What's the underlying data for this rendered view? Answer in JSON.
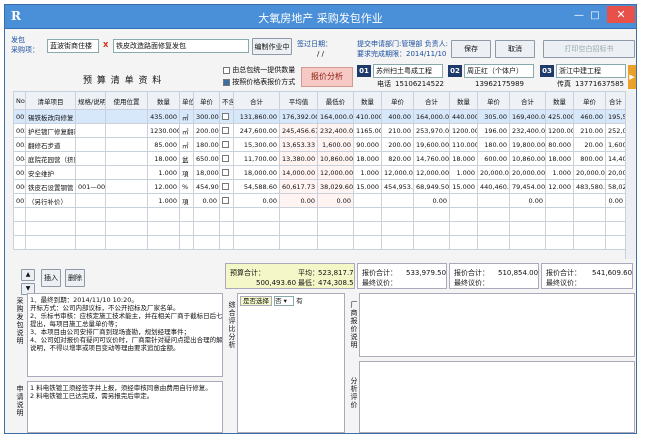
{
  "window": {
    "title": "大氧房地产 采购发包作业",
    "app_icon": "R",
    "min_glyph": "—",
    "max_glyph": "□",
    "close_glyph": "✕"
  },
  "header": {
    "project_label_line1": "发包",
    "project_label_line2": "采购项：",
    "project_value": "蓝波街商住楼",
    "item_value": "铁皮改造路面修复发包",
    "edit_btn": "编制作业中",
    "sign_date_label": "签过日期：",
    "sign_date_value": "/ /",
    "info_line1": "提交申请部门:管理部 负责人:",
    "info_line2": "要求完成期限：2014/11/10",
    "save_btn": "保存",
    "cancel_btn": "取消",
    "print_btn": "打印空白招标书"
  },
  "section": {
    "budget_title": "预 算 清 单 资 料",
    "opt1": "由总包统一提供数量",
    "opt2": "按照价格表报价方式",
    "analysis_btn": "报价分析"
  },
  "vendors": [
    {
      "num": "01",
      "name": "苏州扫土粤成工程",
      "phone_label": "电话",
      "phone": "15106214522"
    },
    {
      "num": "02",
      "name": "周正红（个体户）",
      "phone_label": "",
      "phone": "13962175989"
    },
    {
      "num": "03",
      "name": "浙江中建工程",
      "phone_label": "传真",
      "phone": "13771637585"
    }
  ],
  "columns": {
    "no": "No",
    "item": "清单项目",
    "spec": "规格/说明",
    "unit_pos": "使用位置",
    "qty": "数量",
    "unit": "单位",
    "price": "单价",
    "flag": "不含税",
    "total": "合计",
    "avg": "平均值",
    "low": "最低价",
    "v_qty": "数量",
    "v_price": "单价",
    "v_total": "合计"
  },
  "rows": [
    {
      "no": "001",
      "item": "锡铁板改向修复",
      "spec": "",
      "pos": "",
      "qty": "435.000",
      "unit": "㎡",
      "price": "300.00",
      "flag": "",
      "total": "131,860.00",
      "avg": "176,392.00",
      "low": "164,000.00",
      "v1": [
        "410.000",
        "400.00",
        "164,000.00"
      ],
      "v2": [
        "440.000",
        "305.00",
        "169,400.00"
      ],
      "v3": [
        "425.000",
        "460.00",
        "195,500.00"
      ]
    },
    {
      "no": "002",
      "item": "护栏镀厂修复翻新",
      "spec": "",
      "pos": "",
      "qty": "1230.000",
      "unit": "㎡",
      "price": "200.00",
      "flag": "",
      "total": "247,600.00",
      "avg": "245,456.67",
      "low": "232,400.00",
      "v1": [
        "1165.000",
        "210.00",
        "253,970.00"
      ],
      "v2": [
        "1200.000",
        "196.00",
        "232,400.00"
      ],
      "v3": [
        "1200.000",
        "210.00",
        "252,000.00"
      ]
    },
    {
      "no": "003",
      "item": "翻修石步道",
      "spec": "",
      "pos": "",
      "qty": "85.000",
      "unit": "㎡",
      "price": "180.00",
      "flag": "",
      "total": "15,300.00",
      "avg": "13,653.33",
      "low": "1,600.00",
      "v1": [
        "90.000",
        "200.00",
        "19,600.00"
      ],
      "v2": [
        "110.000",
        "180.00",
        "19,800.00"
      ],
      "v3": [
        "80.000",
        "20.00",
        "1,600.00"
      ]
    },
    {
      "no": "004",
      "item": "庭院花园营（挤压式）",
      "spec": "",
      "pos": "",
      "qty": "18.000",
      "unit": "盆",
      "price": "650.00",
      "flag": "",
      "total": "11,700.00",
      "avg": "13,380.00",
      "low": "10,860.00",
      "v1": [
        "18.000",
        "820.00",
        "14,760.00"
      ],
      "v2": [
        "18.000",
        "600.00",
        "10,860.00"
      ],
      "v3": [
        "18.000",
        "800.00",
        "14,400.00"
      ]
    },
    {
      "no": "005",
      "item": "安全维护",
      "spec": "",
      "pos": "",
      "qty": "1.000",
      "unit": "項",
      "price": "18,000.00",
      "flag": "",
      "total": "18,000.00",
      "avg": "14,000.00",
      "low": "12,000.00",
      "v1": [
        "1.000",
        "12,000.00",
        "12,000.00"
      ],
      "v2": [
        "1.000",
        "20,000.00",
        "20,000.00"
      ],
      "v3": [
        "1.000",
        "20,000.00",
        "20,000.00"
      ]
    },
    {
      "no": "006",
      "item": "铁皮石设置钢管",
      "spec": "001—005",
      "pos": "",
      "qty": "12.000",
      "unit": "%",
      "price": "454,905.00",
      "flag": "",
      "total": "54,588.60",
      "avg": "60,617.73",
      "low": "38,029.60",
      "v1": [
        "15.000",
        "454,953.00",
        "68,949.50"
      ],
      "v2": [
        "15.000",
        "440,460.00",
        "79,454.00"
      ],
      "v3": [
        "12.000",
        "483,580.00",
        "58,029.60"
      ]
    },
    {
      "no": "007",
      "item": "（另行补价）",
      "spec": "",
      "pos": "",
      "qty": "1.000",
      "unit": "項",
      "price": "0.00",
      "flag": "",
      "total": "0.00",
      "avg": "0.00",
      "low": "0.00",
      "v1": [
        "",
        "",
        "0.00"
      ],
      "v2": [
        "",
        "",
        "0.00"
      ],
      "v3": [
        "",
        "",
        "0.00"
      ]
    }
  ],
  "toolbar": {
    "up": "▲",
    "down": "▼",
    "insert": "插入",
    "delete": "删除"
  },
  "summary": {
    "budget_total_label": "预算合计：",
    "budget_total": "500,493.60",
    "avg_label": "平均：",
    "avg_value": "523,817.70",
    "low_label": "最低：",
    "low_value": "474,308.50",
    "v1_total_label": "报价合计：",
    "v1_total": "533,979.50",
    "v1_final_label": "最终议价：",
    "v2_total_label": "报价合计：",
    "v2_total": "510,854.00",
    "v2_final_label": "最终议价：",
    "v3_total_label": "报价合计：",
    "v3_total": "541,609.60",
    "v3_final_label": "最终议价："
  },
  "notes": {
    "left_label": "采购发包说明",
    "left_text": [
      "1、最终到期：2014/11/10 10:20。",
      "   开标方式：公司内部议标，不公开招标及厂家名单。",
      "2、乐标书审核：应核定施工技术能主，并在相关厂商于截标日后七日内",
      "   提出，每项目施工总量单价等；",
      "3、本项目由公司安排厂商到现场查勘，规划经理事件；",
      "4、公司如对报价有疑问可议价时，厂商需针对疑问点提出合理的解释",
      "   说明，不得以增率或项目变动等理由要求追加金额。"
    ],
    "middle_label": "综合评比分析",
    "select_label": "是否选择",
    "select_value": "否",
    "select_suffix": "有",
    "right_label1": "厂商报价说明",
    "right_label2": "分析评价",
    "bottom_label": "申请说明",
    "bottom_text": [
      "1 料电铁镀工须经签字并上报，须经审核同意由费用自行修复。",
      "2 料电铁镀工已达完成，需另报完后审定。"
    ]
  },
  "colors": {
    "titlebar": "#4a90d9",
    "close": "#e8504a",
    "accent_pink": "#f6c9c4",
    "vendor_badge": "#1e3a6a"
  }
}
